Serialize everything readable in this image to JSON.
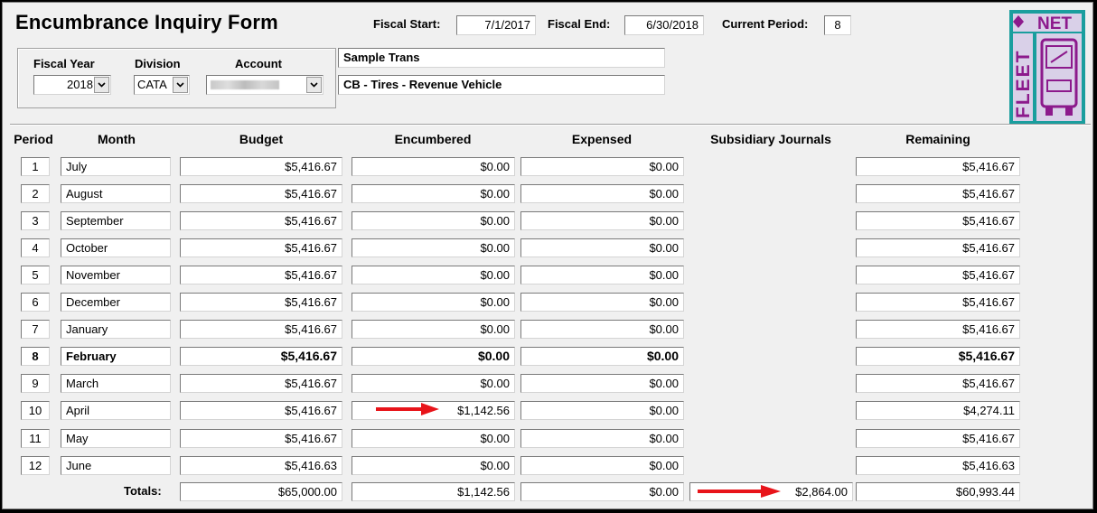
{
  "header": {
    "title": "Encumbrance Inquiry Form",
    "fiscal_start_label": "Fiscal Start:",
    "fiscal_start": "7/1/2017",
    "fiscal_end_label": "Fiscal End:",
    "fiscal_end": "6/30/2018",
    "current_period_label": "Current Period:",
    "current_period": "8"
  },
  "filters": {
    "fiscal_year_label": "Fiscal Year",
    "fiscal_year": "2018",
    "division_label": "Division",
    "division": "CATA",
    "account_label": "Account"
  },
  "description": {
    "line1": "Sample Trans",
    "line2": "CB - Tires - Revenue Vehicle"
  },
  "logo": {
    "word1": "NET",
    "word2": "FLEET",
    "colors": {
      "teal": "#1a9e9e",
      "purple": "#8c1a8c",
      "light": "#d9d0e8"
    }
  },
  "columns": {
    "period": "Period",
    "month": "Month",
    "budget": "Budget",
    "encumbered": "Encumbered",
    "expensed": "Expensed",
    "subsidiary": "Subsidiary Journals",
    "remaining": "Remaining"
  },
  "rows": [
    {
      "period": "1",
      "month": "July",
      "budget": "$5,416.67",
      "encumbered": "$0.00",
      "expensed": "$0.00",
      "remaining": "$5,416.67"
    },
    {
      "period": "2",
      "month": "August",
      "budget": "$5,416.67",
      "encumbered": "$0.00",
      "expensed": "$0.00",
      "remaining": "$5,416.67"
    },
    {
      "period": "3",
      "month": "September",
      "budget": "$5,416.67",
      "encumbered": "$0.00",
      "expensed": "$0.00",
      "remaining": "$5,416.67"
    },
    {
      "period": "4",
      "month": "October",
      "budget": "$5,416.67",
      "encumbered": "$0.00",
      "expensed": "$0.00",
      "remaining": "$5,416.67"
    },
    {
      "period": "5",
      "month": "November",
      "budget": "$5,416.67",
      "encumbered": "$0.00",
      "expensed": "$0.00",
      "remaining": "$5,416.67"
    },
    {
      "period": "6",
      "month": "December",
      "budget": "$5,416.67",
      "encumbered": "$0.00",
      "expensed": "$0.00",
      "remaining": "$5,416.67"
    },
    {
      "period": "7",
      "month": "January",
      "budget": "$5,416.67",
      "encumbered": "$0.00",
      "expensed": "$0.00",
      "remaining": "$5,416.67"
    },
    {
      "period": "8",
      "month": "February",
      "budget": "$5,416.67",
      "encumbered": "$0.00",
      "expensed": "$0.00",
      "remaining": "$5,416.67"
    },
    {
      "period": "9",
      "month": "March",
      "budget": "$5,416.67",
      "encumbered": "$0.00",
      "expensed": "$0.00",
      "remaining": "$5,416.67"
    },
    {
      "period": "10",
      "month": "April",
      "budget": "$5,416.67",
      "encumbered": "$1,142.56",
      "expensed": "$0.00",
      "remaining": "$4,274.11"
    },
    {
      "period": "11",
      "month": "May",
      "budget": "$5,416.67",
      "encumbered": "$0.00",
      "expensed": "$0.00",
      "remaining": "$5,416.67"
    },
    {
      "period": "12",
      "month": "June",
      "budget": "$5,416.63",
      "encumbered": "$0.00",
      "expensed": "$0.00",
      "remaining": "$5,416.63"
    }
  ],
  "totals": {
    "label": "Totals:",
    "budget": "$65,000.00",
    "encumbered": "$1,142.56",
    "expensed": "$0.00",
    "subsidiary": "$2,864.00",
    "remaining": "$60,993.44"
  },
  "annotations": {
    "arrow_color": "#e8141a"
  }
}
